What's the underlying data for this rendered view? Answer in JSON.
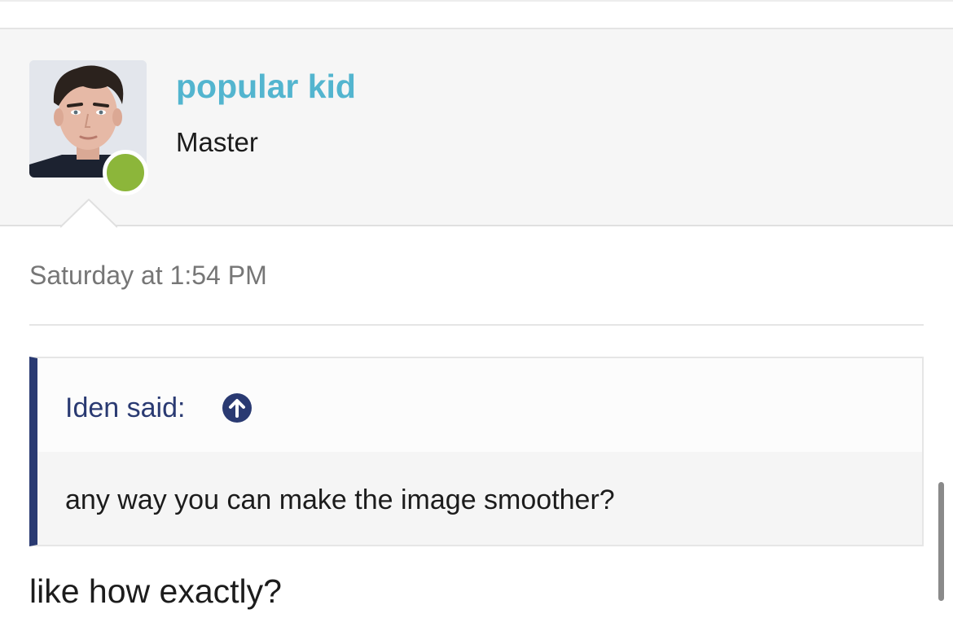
{
  "user": {
    "name": "popular kid",
    "title": "Master",
    "online_color": "#8cb63a",
    "name_color": "#53b5cf"
  },
  "post": {
    "date": "Saturday at 1:54 PM",
    "quote": {
      "author": "Iden said:",
      "text": "any way you can make the image smoother?",
      "jump_icon": "arrow-up-circle-icon",
      "accent_color": "#2a3a72"
    },
    "reply": "like how exactly?"
  }
}
